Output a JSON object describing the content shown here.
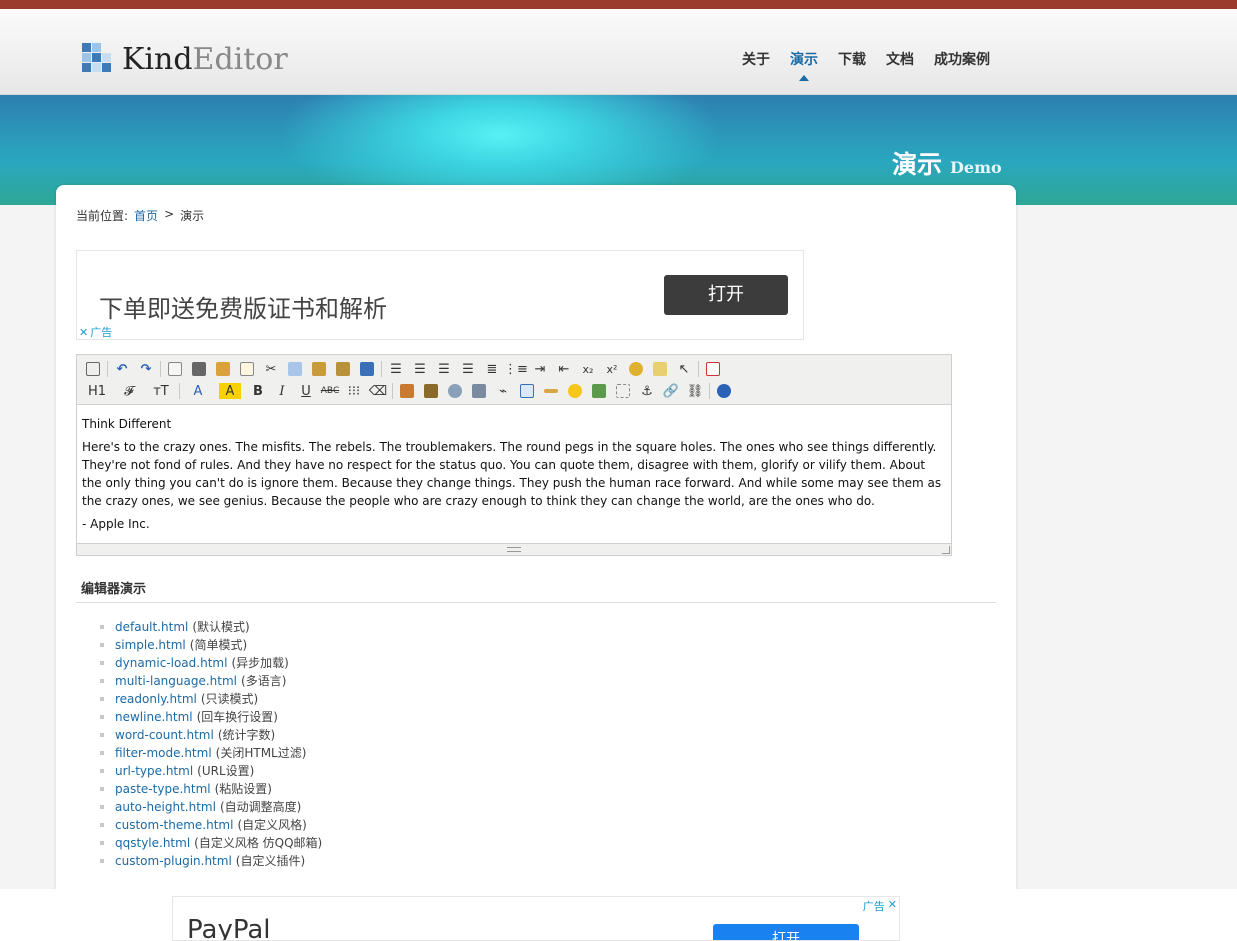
{
  "brand": {
    "kind": "Kind",
    "editor": "Editor"
  },
  "nav": [
    {
      "label": "关于",
      "active": false
    },
    {
      "label": "演示",
      "active": true
    },
    {
      "label": "下载",
      "active": false
    },
    {
      "label": "文档",
      "active": false
    },
    {
      "label": "成功案例",
      "active": false
    }
  ],
  "banner": {
    "title": "演示",
    "subtitle": "Demo"
  },
  "breadcrumb": {
    "prefix": "当前位置:",
    "home": "首页",
    "sep": ">",
    "current": "演示"
  },
  "ad_top": {
    "text": "下单即送免费版证书和解析",
    "button": "打开",
    "tag": "广告",
    "close": "✕"
  },
  "editor": {
    "toolbar_row1": [
      "source",
      "undo",
      "redo",
      "preview",
      "print",
      "template",
      "code",
      "cut",
      "copy",
      "paste",
      "plainpaste",
      "wordpaste",
      "justifyleft",
      "justifycenter",
      "justifyright",
      "justifyfull",
      "insertorderedlist",
      "insertunorderedlist",
      "indent",
      "outdent",
      "subscript",
      "superscript",
      "clearhtml",
      "quickformat",
      "selectall",
      "fullscreen"
    ],
    "toolbar_row2_labels": {
      "formatblock": "H1",
      "fontname": "𝓕",
      "fontsize": "тT",
      "forecolor": "A",
      "hilitecolor": "A",
      "bold": "B",
      "italic": "I",
      "underline": "U",
      "strikethrough": "ABC"
    },
    "content": {
      "heading": "Think Different",
      "paragraph": "Here's to the crazy ones. The misfits. The rebels. The troublemakers. The round pegs in the square holes. The ones who see things differently. They're not fond of rules. And they have no respect for the status quo. You can quote them, disagree with them, glorify or vilify them. About the only thing you can't do is ignore them. Because they change things. They push the human race forward. And while some may see them as the crazy ones, we see genius. Because the people who are crazy enough to think they can change the world, are the ones who do.",
      "signature": "- Apple Inc."
    }
  },
  "section": {
    "title": "编辑器演示"
  },
  "demos": [
    {
      "file": "default.html",
      "desc": "(默认模式)"
    },
    {
      "file": "simple.html",
      "desc": "(简单模式)"
    },
    {
      "file": "dynamic-load.html",
      "desc": "(异步加载)"
    },
    {
      "file": "multi-language.html",
      "desc": "(多语言)"
    },
    {
      "file": "readonly.html",
      "desc": "(只读模式)"
    },
    {
      "file": "newline.html",
      "desc": "(回车换行设置)"
    },
    {
      "file": "word-count.html",
      "desc": "(统计字数)"
    },
    {
      "file": "filter-mode.html",
      "desc": "(关闭HTML过滤)"
    },
    {
      "file": "url-type.html",
      "desc": "(URL设置)"
    },
    {
      "file": "paste-type.html",
      "desc": "(粘贴设置)"
    },
    {
      "file": "auto-height.html",
      "desc": "(自动调整高度)"
    },
    {
      "file": "custom-theme.html",
      "desc": "(自定义风格)"
    },
    {
      "file": "qqstyle.html",
      "desc": "(自定义风格 仿QQ邮箱)"
    },
    {
      "file": "custom-plugin.html",
      "desc": "(自定义插件)"
    }
  ],
  "ad_bottom": {
    "text": "PayPal",
    "tag": "广告",
    "close": "✕",
    "button": "打开"
  },
  "colors": {
    "accent": "#1b6aa5",
    "topbar": "#9a3b2e",
    "banner": "#2aa7bf"
  }
}
